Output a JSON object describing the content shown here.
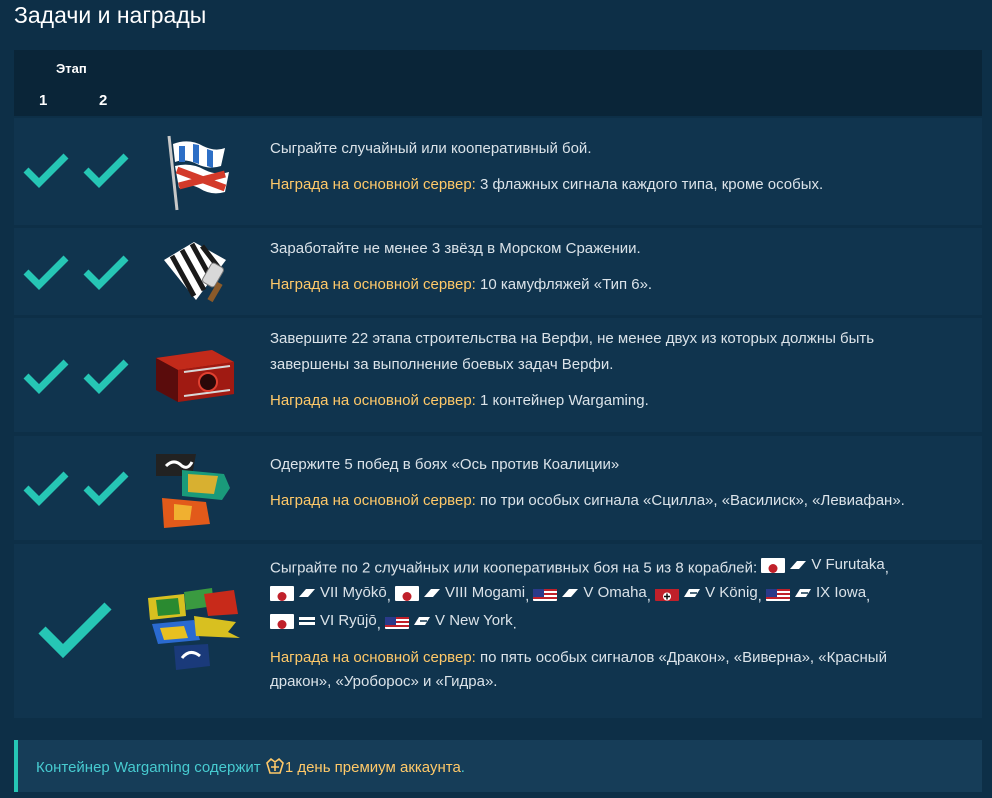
{
  "title": "Задачи и награды",
  "header": {
    "stage_label": "Этап",
    "stages": [
      "1",
      "2"
    ]
  },
  "reward_label": "Награда на основной сервер:",
  "tasks": [
    {
      "task": "Сыграйте случайный или кооперативный бой.",
      "reward": "3 флажных сигнала каждого типа, кроме особых.",
      "stages_done": [
        true,
        true
      ],
      "icon": "signal-flags-icon"
    },
    {
      "task": "Заработайте не менее 3 звёзд в Морском Сражении.",
      "reward": "10 камуфляжей «Тип 6».",
      "stages_done": [
        true,
        true
      ],
      "icon": "camouflage-icon"
    },
    {
      "task_line1": "Завершите 22 этапа строительства на Верфи, не менее двух из которых должны быть",
      "task_line2": "завершены за выполнение боевых задач Верфи.",
      "reward": "1 контейнер Wargaming.",
      "stages_done": [
        true,
        true
      ],
      "icon": "container-icon"
    },
    {
      "task": "Одержите 5 побед в боях «Ось против Коалиции»",
      "reward": "по три особых сигнала «Сцилла», «Василиск», «Левиафан».",
      "stages_done": [
        true,
        true
      ],
      "icon": "special-signals-icon"
    },
    {
      "task_prefix": "Сыграйте по 2 случайных или кооперативных боя на 5 из 8 кораблей:",
      "ships": [
        {
          "name": "V Furutaka",
          "nation": "japan",
          "class": "cruiser"
        },
        {
          "name": "VII Myōkō",
          "nation": "japan",
          "class": "cruiser"
        },
        {
          "name": "VIII Mogami",
          "nation": "japan",
          "class": "cruiser"
        },
        {
          "name": "V Omaha",
          "nation": "usa",
          "class": "cruiser"
        },
        {
          "name": "V König",
          "nation": "germany",
          "class": "battleship"
        },
        {
          "name": "IX Iowa",
          "nation": "usa",
          "class": "battleship"
        },
        {
          "name": "VI Ryūjō",
          "nation": "japan",
          "class": "carrier"
        },
        {
          "name": "V New York",
          "nation": "usa",
          "class": "battleship"
        }
      ],
      "reward_line1": "по пять особых сигналов «Дракон», «Виверна», «Красный",
      "reward_line2": "дракон», «Уроборос» и «Гидра».",
      "stages_done": [
        true
      ],
      "icon": "dragon-signals-icon"
    }
  ],
  "info": {
    "prefix": "Контейнер Wargaming содержит",
    "premium": "1 день премиум аккаунта",
    "suffix": "."
  },
  "colors": {
    "check": "#26c6b5",
    "reward_label": "#ffc969",
    "info_text": "#47cbd0"
  }
}
